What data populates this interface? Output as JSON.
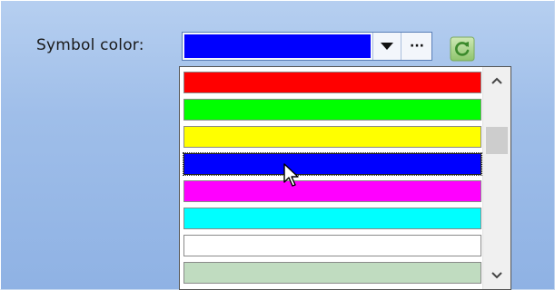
{
  "symbol_color": {
    "label": "Symbol color:",
    "selected_color": "#0000ff"
  },
  "icons": {
    "dropdown_arrow": "chevron-down-icon",
    "ellipsis": "more-options-icon",
    "reset": "refresh-icon",
    "scroll_up": "chevron-up-icon",
    "scroll_down": "chevron-down-icon",
    "cursor": "mouse-pointer-icon"
  },
  "ellipsis_text": "···",
  "color_list": [
    {
      "name": "red",
      "color": "#ff0000"
    },
    {
      "name": "lime",
      "color": "#00ff00"
    },
    {
      "name": "yellow",
      "color": "#ffff00"
    },
    {
      "name": "blue",
      "color": "#0000ff",
      "selected": true
    },
    {
      "name": "magenta",
      "color": "#ff00ff"
    },
    {
      "name": "cyan",
      "color": "#00ffff"
    },
    {
      "name": "white",
      "color": "#ffffff"
    },
    {
      "name": "light-green",
      "color": "#c0dcc0"
    }
  ]
}
